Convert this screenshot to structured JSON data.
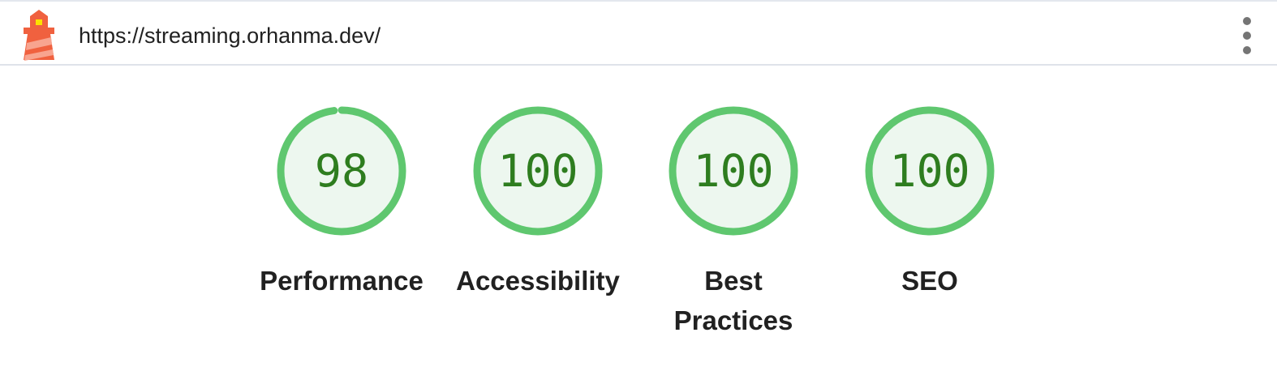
{
  "header": {
    "url": "https://streaming.orhanma.dev/",
    "logo_icon": "lighthouse-icon",
    "menu_icon": "more-vert-icon"
  },
  "colors": {
    "pass_ring": "#5fc76f",
    "pass_fill": "#edf7ef",
    "pass_text": "#2e7d1f",
    "label_text": "#212121"
  },
  "gauges": [
    {
      "category": "Performance",
      "score": 98
    },
    {
      "category": "Accessibility",
      "score": 100
    },
    {
      "category": "Best Practices",
      "score": 100
    },
    {
      "category": "SEO",
      "score": 100
    }
  ]
}
